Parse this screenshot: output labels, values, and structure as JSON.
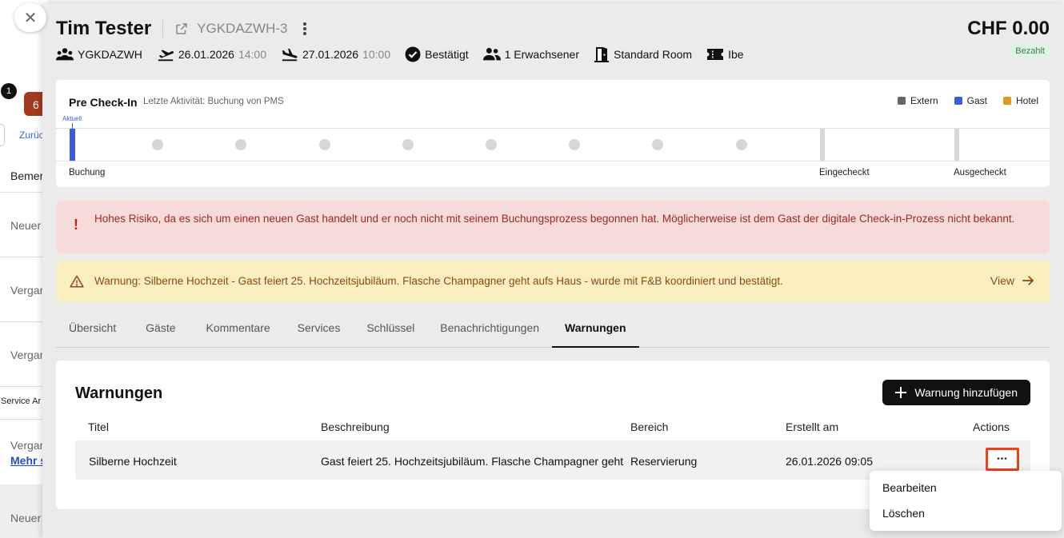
{
  "background": {
    "close_glyph": "✕",
    "badge_count": "1",
    "red_count": "6",
    "back_link": "Zurüc",
    "texts": [
      "Bemer",
      "Neuer",
      "Vergar",
      "Vergar",
      "Vergar",
      "Neuer"
    ],
    "service_label": "Service Ar",
    "link_text": "Mehr s"
  },
  "header": {
    "guest_name": "Tim Tester",
    "reservation_code": "YGKDAZWH-3",
    "price": "CHF 0.00",
    "payment_status": "Bezahlt"
  },
  "meta": {
    "booking_id": "YGKDAZWH",
    "arrival_date": "26.01.2026",
    "arrival_time": "14:00",
    "departure_date": "27.01.2026",
    "departure_time": "10:00",
    "status": "Bestätigt",
    "guests": "1 Erwachsener",
    "room": "Standard Room",
    "channel": "Ibe"
  },
  "precheckin": {
    "title": "Pre Check-In",
    "last_activity": "Letzte Aktivität: Buchung von PMS",
    "current_label": "Aktuell",
    "legend": [
      {
        "label": "Extern",
        "color": "#666666"
      },
      {
        "label": "Gast",
        "color": "#3b5bdb"
      },
      {
        "label": "Hotel",
        "color": "#e09a1f"
      }
    ],
    "milestones": {
      "booking": "Buchung",
      "checked_in": "Eingecheckt",
      "checked_out": "Ausgecheckt"
    }
  },
  "alerts": {
    "risk_icon": "!",
    "risk_text": "Hohes Risiko, da es sich um einen neuen Gast handelt und er noch nicht mit seinem Buchungsprozess begonnen hat. Möglicherweise ist dem Gast der digitale Check-in-Prozess nicht bekannt.",
    "warning_text": "Warnung: Silberne Hochzeit - Gast feiert 25. Hochzeitsjubiläum. Flasche Champagner geht aufs Haus - wurde mit F&B koordiniert und bestätigt.",
    "view_label": "View"
  },
  "tabs": [
    "Übersicht",
    "Gäste",
    "Kommentare",
    "Services",
    "Schlüssel",
    "Benachrichtigungen",
    "Warnungen"
  ],
  "warnings": {
    "title": "Warnungen",
    "add_label": "Warnung hinzufügen",
    "columns": [
      "Titel",
      "Beschreibung",
      "Bereich",
      "Erstellt am",
      "Actions"
    ],
    "rows": [
      {
        "title": "Silberne Hochzeit",
        "description": "Gast feiert 25. Hochzeitsjubiläum. Flasche Champagner geht",
        "area": "Reservierung",
        "created": "26.01.2026 09:05",
        "actions_glyph": "•••"
      }
    ]
  },
  "menu": {
    "edit": "Bearbeiten",
    "delete": "Löschen"
  }
}
